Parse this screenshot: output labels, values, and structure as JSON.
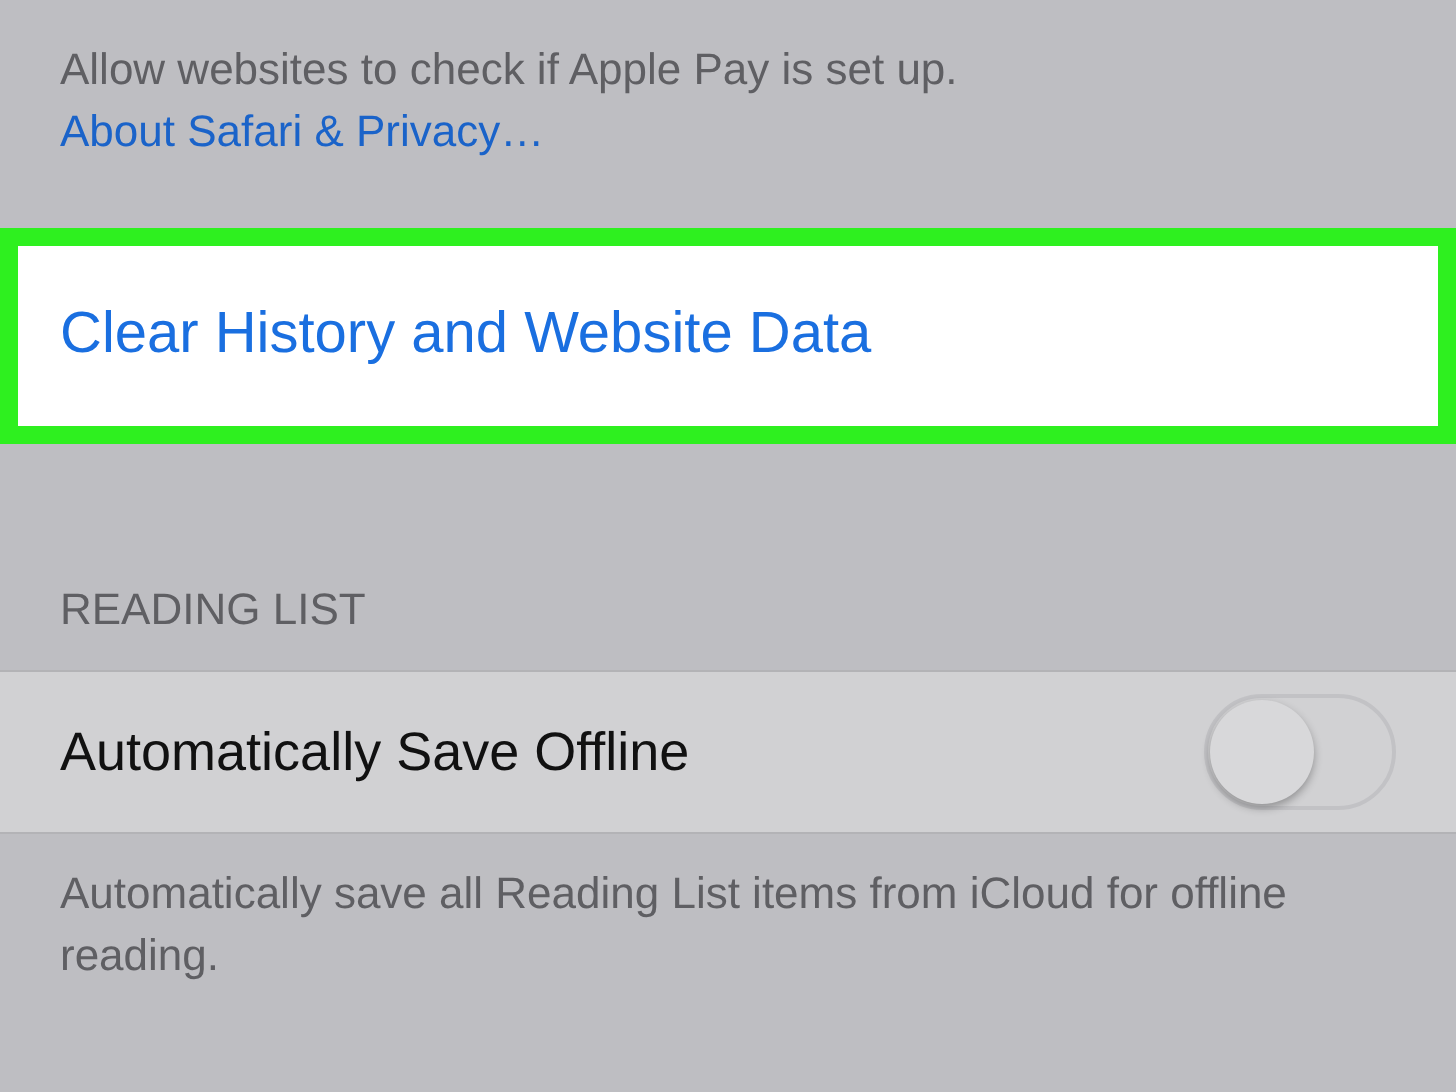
{
  "apple_pay_footer": {
    "text": "Allow websites to check if Apple Pay is set up.",
    "link": "About Safari & Privacy…"
  },
  "clear_row": {
    "label": "Clear History and Website Data",
    "highlighted": true
  },
  "reading_list": {
    "header": "READING LIST",
    "rows": [
      {
        "label": "Automatically Save Offline",
        "kind": "toggle",
        "on": false
      }
    ],
    "footer": "Automatically save all Reading List items from iCloud for offline reading."
  }
}
